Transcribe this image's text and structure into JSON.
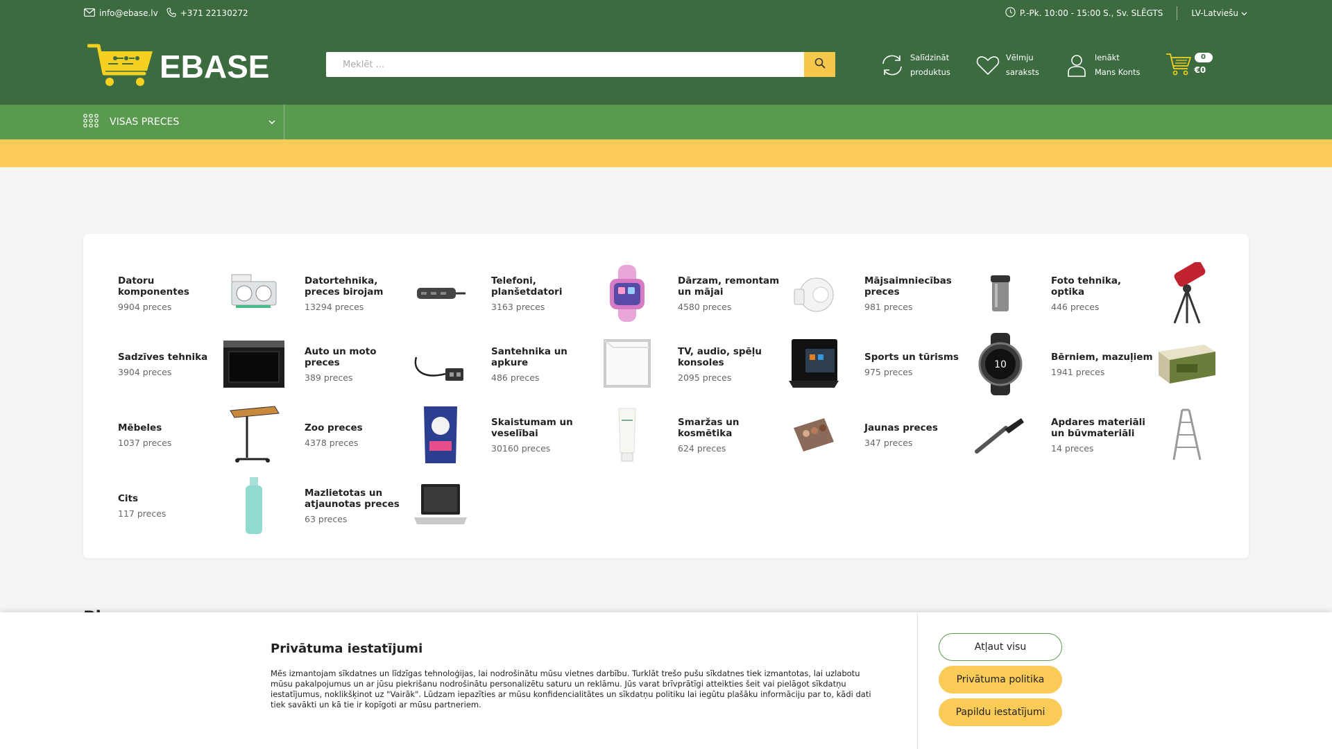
{
  "topbar": {
    "email": "info@ebase.lv",
    "phone": "+371 22130272",
    "hours": "P.-Pk. 10:00 - 15:00 S., Sv. SLĒGTS",
    "language": "LV-Latviešu"
  },
  "header": {
    "logo_text": "EBASE",
    "search_placeholder": "Meklēt ...",
    "compare_line1": "Salīdzināt",
    "compare_line2": "produktus",
    "wishlist_line1": "Vēlmju",
    "wishlist_line2": "saraksts",
    "account_line1": "Ienākt",
    "account_line2": "Mans Konts",
    "cart_count": "0",
    "cart_total": "€0"
  },
  "nav": {
    "all_categories": "VISAS PRECES"
  },
  "categories": [
    {
      "name": "Datoru komponentes",
      "count": "9904 preces",
      "icon": "graphics-card-icon"
    },
    {
      "name": "Datortehnika, preces birojam",
      "count": "13294 preces",
      "icon": "usb-hub-icon"
    },
    {
      "name": "Telefoni, planšetdatori",
      "count": "3163 preces",
      "icon": "smartwatch-icon"
    },
    {
      "name": "Dārzam, remontam un mājai",
      "count": "4580 preces",
      "icon": "motion-sensor-icon"
    },
    {
      "name": "Mājsaimniecības preces",
      "count": "981 preces",
      "icon": "thermos-cup-icon"
    },
    {
      "name": "Foto tehnika, optika",
      "count": "446 preces",
      "icon": "telescope-icon"
    },
    {
      "name": "Sadzīves tehnika",
      "count": "3904 preces",
      "icon": "oven-icon"
    },
    {
      "name": "Auto un moto preces",
      "count": "389 preces",
      "icon": "cable-adapter-icon"
    },
    {
      "name": "Santehnika un apkure",
      "count": "486 preces",
      "icon": "frame-icon"
    },
    {
      "name": "TV, audio, spēļu konsoles",
      "count": "2095 preces",
      "icon": "tablet-dock-icon"
    },
    {
      "name": "Sports un tūrisms",
      "count": "975 preces",
      "icon": "sport-watch-icon"
    },
    {
      "name": "Bērniem, mazuļiem",
      "count": "1941 preces",
      "icon": "lego-box-icon"
    },
    {
      "name": "Mēbeles",
      "count": "1037 preces",
      "icon": "side-table-icon"
    },
    {
      "name": "Zoo preces",
      "count": "4378 preces",
      "icon": "pet-food-icon"
    },
    {
      "name": "Skaistumam un veselībai",
      "count": "30160 preces",
      "icon": "cream-tube-icon"
    },
    {
      "name": "Smaržas un kosmētika",
      "count": "624 preces",
      "icon": "eyeshadow-palette-icon"
    },
    {
      "name": "Jaunas preces",
      "count": "347 preces",
      "icon": "brush-icon"
    },
    {
      "name": "Apdares materiāli un būvmateriāli",
      "count": "14 preces",
      "icon": "ladder-icon"
    },
    {
      "name": "Cits",
      "count": "117 preces",
      "icon": "bottle-icon"
    },
    {
      "name": "Mazlietotas un atjaunotas preces",
      "count": "63 preces",
      "icon": "laptop-icon"
    }
  ],
  "section_peek": "Pi...",
  "cookie": {
    "title": "Privātuma iestatījumi",
    "text": "Mēs izmantojam sīkdatnes un līdzīgas tehnoloģijas, lai nodrošinātu mūsu vietnes darbību. Turklāt trešo pušu sīkdatnes tiek izmantotas, lai uzlabotu mūsu pakalpojumus un ar jūsu piekrišanu nodrošinātu personalizētu saturu un reklāmu. Jūs varat brīvprātīgi atteikties šeit vai pielāgot sīkdatņu iestatījumus, noklikšķinot uz \"Vairāk\". Lūdzam iepazīties ar mūsu konfidencialitātes un sīkdatņu politiku lai iegūtu plašāku informāciju par to, kādi dati tiek savākti un kā tie ir kopīgoti ar mūsu partneriem.",
    "allow_all": "Atļaut visu",
    "privacy_policy": "Privātuma politika",
    "more_settings": "Papildu iestatījumi"
  },
  "colors": {
    "header_green": "#3b6b3f",
    "nav_green": "#5a9a4f",
    "accent_yellow": "#fbcb57"
  }
}
